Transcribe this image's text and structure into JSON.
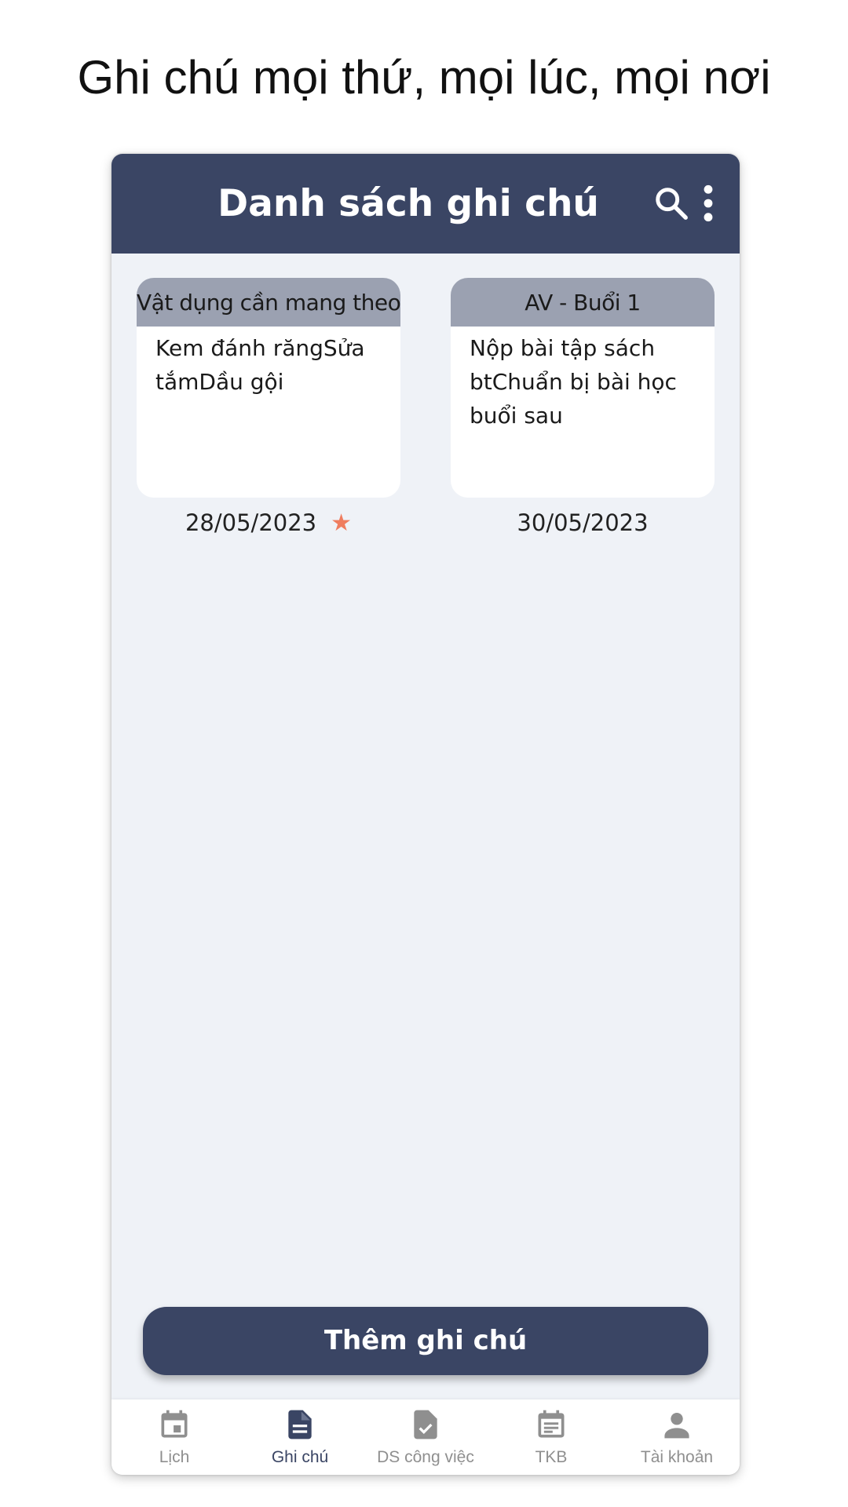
{
  "promo": {
    "title": "Ghi chú mọi thứ, mọi lúc, mọi nơi"
  },
  "appbar": {
    "title": "Danh sách ghi chú"
  },
  "notes": [
    {
      "title": "Vật dụng cần mang theo",
      "body": "Kem đánh răngSửa tắmDầu gội",
      "date": "28/05/2023",
      "starred": true
    },
    {
      "title": "AV - Buổi 1",
      "body": "Nộp bài tập sách btChuẩn bị bài học buổi sau",
      "date": "30/05/2023",
      "starred": false
    }
  ],
  "add_button": {
    "label": "Thêm ghi chú"
  },
  "bottom_nav": {
    "active_index": 1,
    "items": [
      {
        "label": "Lịch",
        "icon": "calendar-icon"
      },
      {
        "label": "Ghi chú",
        "icon": "note-icon"
      },
      {
        "label": "DS công việc",
        "icon": "task-file-icon"
      },
      {
        "label": "TKB",
        "icon": "timetable-icon"
      },
      {
        "label": "Tài khoản",
        "icon": "account-icon"
      }
    ]
  },
  "colors": {
    "primary": "#3a4564",
    "note_header": "#9ba1b1",
    "background": "#eff2f7",
    "star": "#ef7d5f",
    "nav_inactive": "#8f8f8f"
  }
}
